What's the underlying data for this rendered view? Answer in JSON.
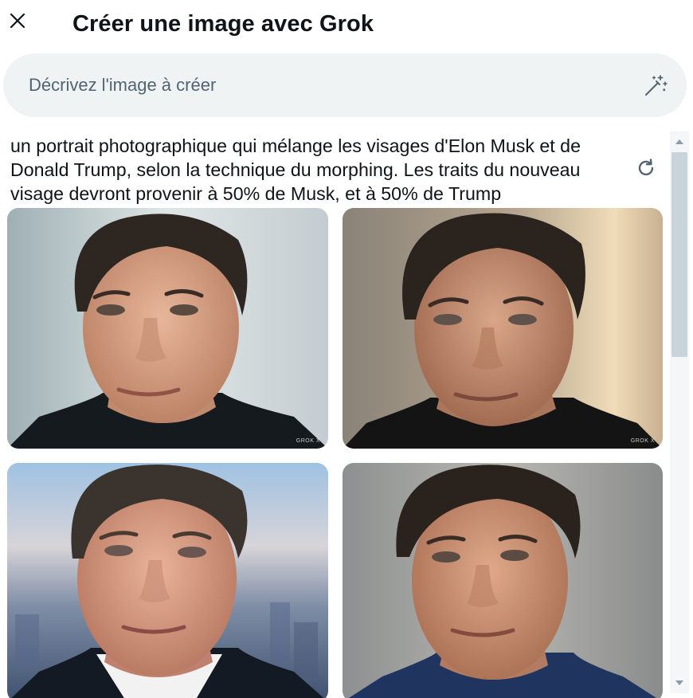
{
  "header": {
    "close_icon": "close-icon",
    "title": "Créer une image avec Grok"
  },
  "search": {
    "placeholder": "Décrivez l'image à créer",
    "value": "",
    "icon": "magic-wand-icon"
  },
  "result": {
    "prompt": "un portrait photographique qui mélange les visages d'Elon Musk et de Donald Trump, selon la technique du morphing. Les traits du nouveau visage devront provenir à 50% de Musk, et à 50% de Trump",
    "refresh_icon": "refresh-icon",
    "images": [
      {
        "watermark": "GROK X"
      },
      {
        "watermark": "GROK X"
      },
      {
        "watermark": ""
      },
      {
        "watermark": ""
      }
    ]
  },
  "colors": {
    "search_bg": "#eff3f4",
    "placeholder": "#536471",
    "text": "#0f1419",
    "scrollbar_thumb": "#c8d3dc"
  }
}
